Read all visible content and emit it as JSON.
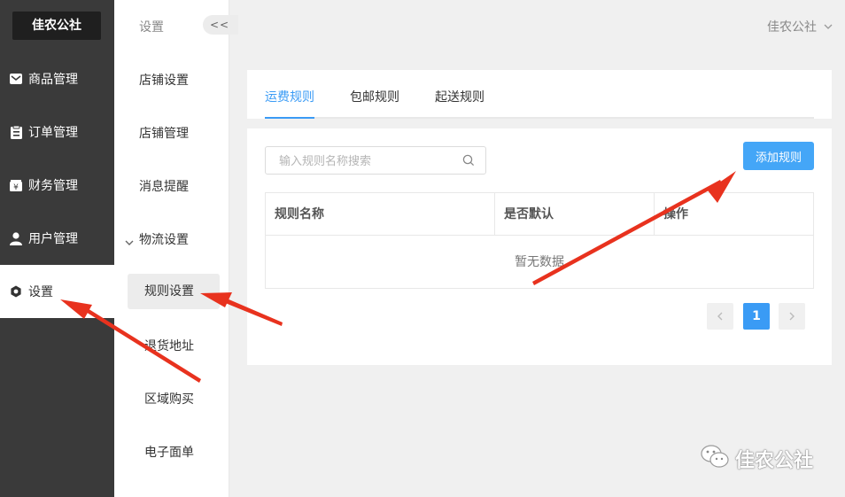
{
  "brand": "佳农公社",
  "sidebar": {
    "items": [
      {
        "label": "商品管理",
        "icon": "mail-icon"
      },
      {
        "label": "订单管理",
        "icon": "clipboard-icon"
      },
      {
        "label": "财务管理",
        "icon": "wallet-icon"
      },
      {
        "label": "用户管理",
        "icon": "user-icon"
      },
      {
        "label": "设置",
        "icon": "gear-icon",
        "active": true
      }
    ]
  },
  "submenu": {
    "title": "设置",
    "collapse_label": "<<",
    "items": [
      "店铺设置",
      "店铺管理",
      "消息提醒"
    ],
    "group": {
      "label": "物流设置",
      "children": [
        "规则设置",
        "退货地址",
        "区域购买",
        "电子面单"
      ],
      "active_child": "规则设置"
    }
  },
  "header": {
    "user_name": "佳农公社"
  },
  "tabs": [
    {
      "label": "运费规则",
      "active": true
    },
    {
      "label": "包邮规则",
      "active": false
    },
    {
      "label": "起送规则",
      "active": false
    }
  ],
  "search": {
    "placeholder": "输入规则名称搜索",
    "value": ""
  },
  "toolbar": {
    "add_label": "添加规则"
  },
  "table": {
    "columns": [
      "规则名称",
      "是否默认",
      "操作"
    ],
    "rows": [],
    "empty_text": "暂无数据"
  },
  "pagination": {
    "current": "1"
  },
  "watermark": {
    "text": "佳农公社"
  },
  "colors": {
    "accent": "#3a9bf5",
    "sidebar_bg": "#3a3a3a",
    "arrow": "#e8321e"
  }
}
